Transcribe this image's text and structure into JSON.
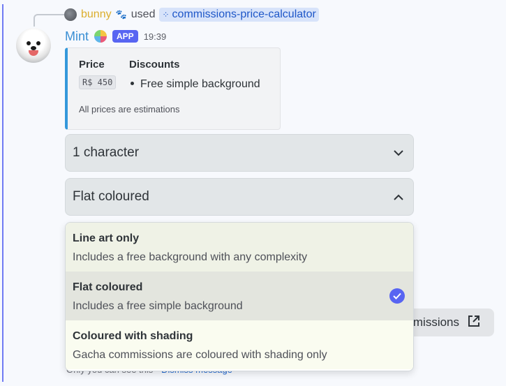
{
  "reply": {
    "user": "bunny",
    "decor": "🐾",
    "used": "used",
    "command": "commissions-price-calculator"
  },
  "author": {
    "name": "Mint",
    "emoji": "🍭",
    "badge": "APP",
    "time": "19:39"
  },
  "embed": {
    "price_label": "Price",
    "price_value": "R$ 450",
    "discounts_label": "Discounts",
    "discounts": [
      "Free simple background"
    ],
    "note": "All prices are estimations",
    "accent_color": "#3498db"
  },
  "selects": {
    "characters": "1 character",
    "style": "Flat coloured"
  },
  "side_button": {
    "label": "missions"
  },
  "ephemeral": {
    "text": "Only you can see this • ",
    "dismiss": "Dismiss message"
  },
  "menu": {
    "options": [
      {
        "label": "Line art only",
        "description": "Includes a free background with any complexity",
        "selected": false
      },
      {
        "label": "Flat coloured",
        "description": "Includes a free simple background",
        "selected": true
      },
      {
        "label": "Coloured with shading",
        "description": "Gacha commissions are coloured with shading only",
        "selected": false
      }
    ]
  },
  "icons": {
    "dropdown_closed": "chevron-down-icon",
    "dropdown_open": "chevron-up-icon",
    "selected": "check-circle-icon",
    "external": "external-link-icon"
  },
  "colors": {
    "accent": "#5865f2",
    "author_name": "#3a8fd4",
    "reply_user": "#dcae2c",
    "link": "#1e66d0"
  }
}
